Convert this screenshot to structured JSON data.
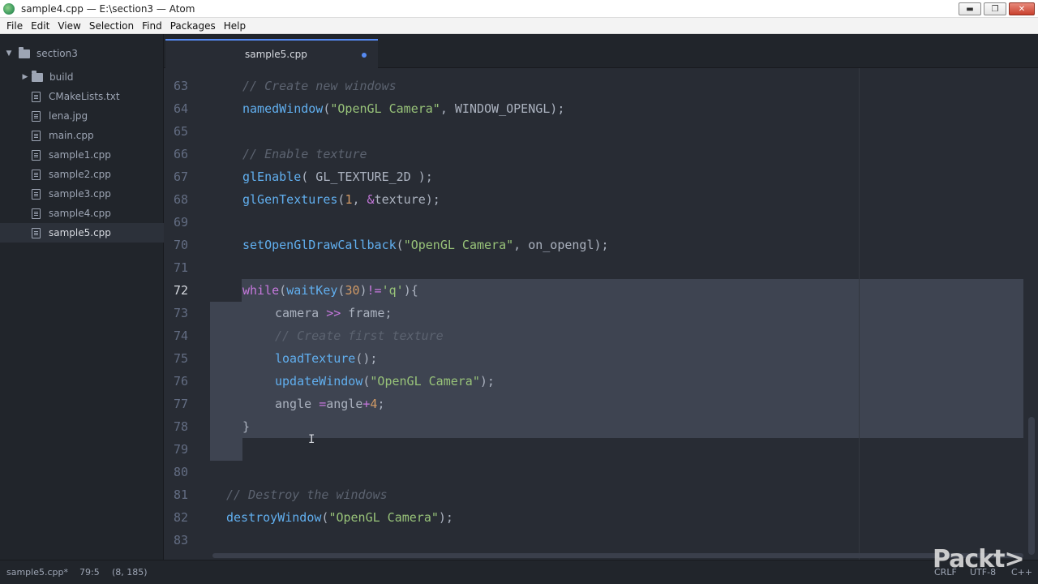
{
  "window": {
    "title": "sample4.cpp — E:\\section3 — Atom",
    "minimize": "▬",
    "maximize": "❐",
    "close": "✕"
  },
  "menu": [
    "File",
    "Edit",
    "View",
    "Selection",
    "Find",
    "Packages",
    "Help"
  ],
  "sidebar": {
    "root": "section3",
    "items": [
      {
        "label": "build",
        "type": "folder"
      },
      {
        "label": "CMakeLists.txt",
        "type": "file"
      },
      {
        "label": "lena.jpg",
        "type": "file"
      },
      {
        "label": "main.cpp",
        "type": "file"
      },
      {
        "label": "sample1.cpp",
        "type": "file"
      },
      {
        "label": "sample2.cpp",
        "type": "file"
      },
      {
        "label": "sample3.cpp",
        "type": "file"
      },
      {
        "label": "sample4.cpp",
        "type": "file"
      },
      {
        "label": "sample5.cpp",
        "type": "file",
        "selected": true
      }
    ]
  },
  "tabs": [
    {
      "label": "sample5.cpp",
      "modified": true,
      "active": true
    }
  ],
  "editor": {
    "line_numbers": [
      "63",
      "64",
      "65",
      "66",
      "67",
      "68",
      "69",
      "70",
      "71",
      "72",
      "73",
      "74",
      "75",
      "76",
      "77",
      "78",
      "79",
      "80",
      "81",
      "82",
      "83"
    ],
    "current_line": "72",
    "lines": [
      {
        "indent": "  ",
        "tokens": [
          {
            "t": "// Create new windows",
            "c": "cm"
          }
        ]
      },
      {
        "indent": "  ",
        "tokens": [
          {
            "t": "namedWindow",
            "c": "fn"
          },
          {
            "t": "(",
            "c": ""
          },
          {
            "t": "\"OpenGL Camera\"",
            "c": "st"
          },
          {
            "t": ", WINDOW_OPENGL);",
            "c": ""
          }
        ]
      },
      {
        "indent": "",
        "tokens": []
      },
      {
        "indent": "  ",
        "tokens": [
          {
            "t": "// Enable texture",
            "c": "cm"
          }
        ]
      },
      {
        "indent": "  ",
        "tokens": [
          {
            "t": "glEnable",
            "c": "fn"
          },
          {
            "t": "( GL_TEXTURE_2D );",
            "c": ""
          }
        ]
      },
      {
        "indent": "  ",
        "tokens": [
          {
            "t": "glGenTextures",
            "c": "fn"
          },
          {
            "t": "(",
            "c": ""
          },
          {
            "t": "1",
            "c": "nm"
          },
          {
            "t": ", ",
            "c": ""
          },
          {
            "t": "&",
            "c": "kw"
          },
          {
            "t": "texture);",
            "c": ""
          }
        ]
      },
      {
        "indent": "",
        "tokens": []
      },
      {
        "indent": "  ",
        "tokens": [
          {
            "t": "setOpenGlDrawCallback",
            "c": "fn"
          },
          {
            "t": "(",
            "c": ""
          },
          {
            "t": "\"OpenGL Camera\"",
            "c": "st"
          },
          {
            "t": ", on_opengl);",
            "c": ""
          }
        ]
      },
      {
        "indent": "",
        "tokens": []
      },
      {
        "indent": "  ",
        "tokens": [
          {
            "t": "while",
            "c": "kw"
          },
          {
            "t": "(",
            "c": ""
          },
          {
            "t": "waitKey",
            "c": "fn"
          },
          {
            "t": "(",
            "c": ""
          },
          {
            "t": "30",
            "c": "nm"
          },
          {
            "t": ")",
            "c": ""
          },
          {
            "t": "!=",
            "c": "kw"
          },
          {
            "t": "'q'",
            "c": "st"
          },
          {
            "t": "){",
            "c": ""
          }
        ]
      },
      {
        "indent": "      ",
        "tokens": [
          {
            "t": "camera ",
            "c": ""
          },
          {
            "t": ">>",
            "c": "kw"
          },
          {
            "t": " frame;",
            "c": ""
          }
        ]
      },
      {
        "indent": "      ",
        "tokens": [
          {
            "t": "// Create first texture",
            "c": "cm"
          }
        ]
      },
      {
        "indent": "      ",
        "tokens": [
          {
            "t": "loadTexture",
            "c": "fn"
          },
          {
            "t": "();",
            "c": ""
          }
        ]
      },
      {
        "indent": "      ",
        "tokens": [
          {
            "t": "updateWindow",
            "c": "fn"
          },
          {
            "t": "(",
            "c": ""
          },
          {
            "t": "\"OpenGL Camera\"",
            "c": "st"
          },
          {
            "t": ");",
            "c": ""
          }
        ]
      },
      {
        "indent": "      ",
        "tokens": [
          {
            "t": "angle ",
            "c": ""
          },
          {
            "t": "=",
            "c": "kw"
          },
          {
            "t": "angle",
            "c": ""
          },
          {
            "t": "+",
            "c": "kw"
          },
          {
            "t": "4",
            "c": "nm"
          },
          {
            "t": ";",
            "c": ""
          }
        ]
      },
      {
        "indent": "  ",
        "tokens": [
          {
            "t": "}",
            "c": ""
          }
        ]
      },
      {
        "indent": "",
        "tokens": []
      },
      {
        "indent": "",
        "tokens": []
      },
      {
        "indent": "",
        "tokens": [
          {
            "t": "// Destroy the windows",
            "c": "cm"
          }
        ]
      },
      {
        "indent": "",
        "tokens": [
          {
            "t": "destroyWindow",
            "c": "fn"
          },
          {
            "t": "(",
            "c": ""
          },
          {
            "t": "\"OpenGL Camera\"",
            "c": "st"
          },
          {
            "t": ");",
            "c": ""
          }
        ]
      },
      {
        "indent": "",
        "tokens": []
      }
    ]
  },
  "status": {
    "file": "sample5.cpp*",
    "cursor": "79:5",
    "selection": "(8, 185)",
    "line_ending": "CRLF",
    "encoding": "UTF-8",
    "grammar": "C++"
  },
  "watermark": "Packt>",
  "colors": {
    "accent": "#568af2",
    "editor_bg": "#282c34",
    "selection": "#3e4451"
  }
}
